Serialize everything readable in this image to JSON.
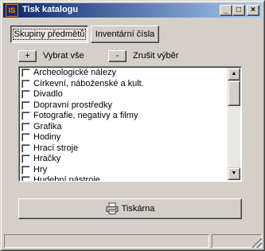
{
  "window": {
    "title": "Tisk katalogu",
    "icon_text": "IS"
  },
  "title_buttons": {
    "minimize": "_",
    "maximize": "□",
    "close": "×"
  },
  "tabs": [
    {
      "label": "Skupiny předmětů",
      "selected": true
    },
    {
      "label": "Inventární čísla",
      "selected": false
    }
  ],
  "controls": {
    "select_all_button": "+",
    "select_all_label": "Vybrat vše",
    "deselect_button": "-",
    "deselect_label": "Zrušit výběr"
  },
  "list": {
    "items": [
      {
        "label": "Archeologické nálezy",
        "checked": false
      },
      {
        "label": "Církevní, náboženské a kult.",
        "checked": false
      },
      {
        "label": "Divadlo",
        "checked": false
      },
      {
        "label": "Dopravní prostředky",
        "checked": false
      },
      {
        "label": "Fotografie, negativy a filmy",
        "checked": false
      },
      {
        "label": "Grafika",
        "checked": false
      },
      {
        "label": "Hodiny",
        "checked": false
      },
      {
        "label": "Hrací stroje",
        "checked": false
      },
      {
        "label": "Hračky",
        "checked": false
      },
      {
        "label": "Hry",
        "checked": false
      },
      {
        "label": "Hudební nástroje",
        "checked": false
      }
    ]
  },
  "print_button": {
    "label": "Tiskárna",
    "icon": "printer-icon"
  },
  "icons": {
    "scroll_up": "▲",
    "scroll_down": "▼"
  },
  "status_bar": {
    "panel1": "",
    "panel2": ""
  }
}
